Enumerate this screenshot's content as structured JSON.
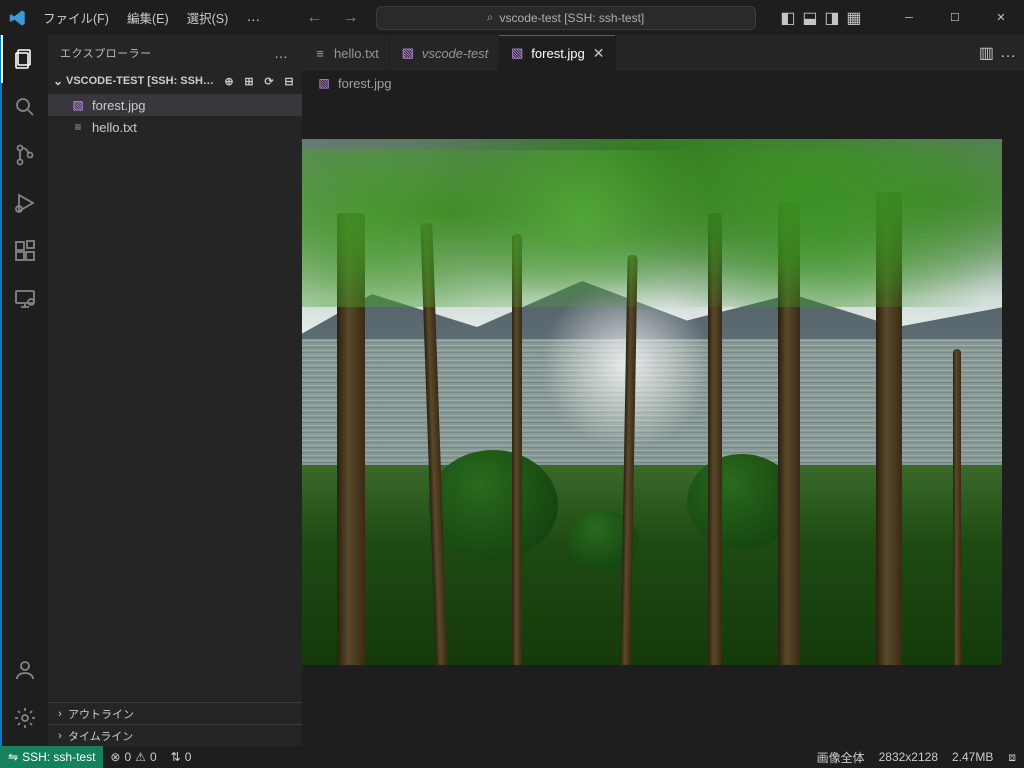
{
  "menu": {
    "file": "ファイル(F)",
    "edit": "編集(E)",
    "select": "選択(S)",
    "more": "…"
  },
  "nav": {
    "back": "←",
    "forward": "→"
  },
  "command_center": {
    "search_glyph": "⌕",
    "text": "vscode-test [SSH: ssh-test]"
  },
  "window": {
    "min": "─",
    "max": "☐",
    "close": "✕"
  },
  "sidebar": {
    "title": "エクスプローラー",
    "more": "…",
    "section": {
      "chevron": "⌄",
      "name": "VSCODE-TEST [SSH: SSH…"
    },
    "actions": {
      "newfile": "⊕",
      "newfolder": "⊞",
      "refresh": "⟳",
      "collapse": "⊟"
    },
    "tree": [
      {
        "icon": "▧",
        "label": "forest.jpg",
        "kind": "img",
        "selected": true
      },
      {
        "icon": "≡",
        "label": "hello.txt",
        "kind": "txt",
        "selected": false
      }
    ],
    "outline": {
      "chevron": "›",
      "label": "アウトライン"
    },
    "timeline": {
      "chevron": "›",
      "label": "タイムライン"
    }
  },
  "tabs": [
    {
      "icon": "≡",
      "label": "hello.txt",
      "kind": "txt",
      "active": false,
      "italic": false
    },
    {
      "icon": "▧",
      "label": "vscode-test",
      "kind": "img",
      "active": false,
      "italic": true
    },
    {
      "icon": "▧",
      "label": "forest.jpg",
      "kind": "img",
      "active": true,
      "italic": false
    }
  ],
  "tab_actions": {
    "split": "▥",
    "more": "…"
  },
  "breadcrumb": {
    "icon": "▧",
    "label": "forest.jpg"
  },
  "status": {
    "remote_icon": "⇋",
    "remote_text": "SSH: ssh-test",
    "errors_icon": "⊗",
    "errors": "0",
    "warnings_icon": "⚠",
    "warnings": "0",
    "ports_icon": "⇅",
    "ports": "0",
    "image_label": "画像全体",
    "dimensions": "2832x2128",
    "size": "2.47MB",
    "bell": "⧈"
  }
}
